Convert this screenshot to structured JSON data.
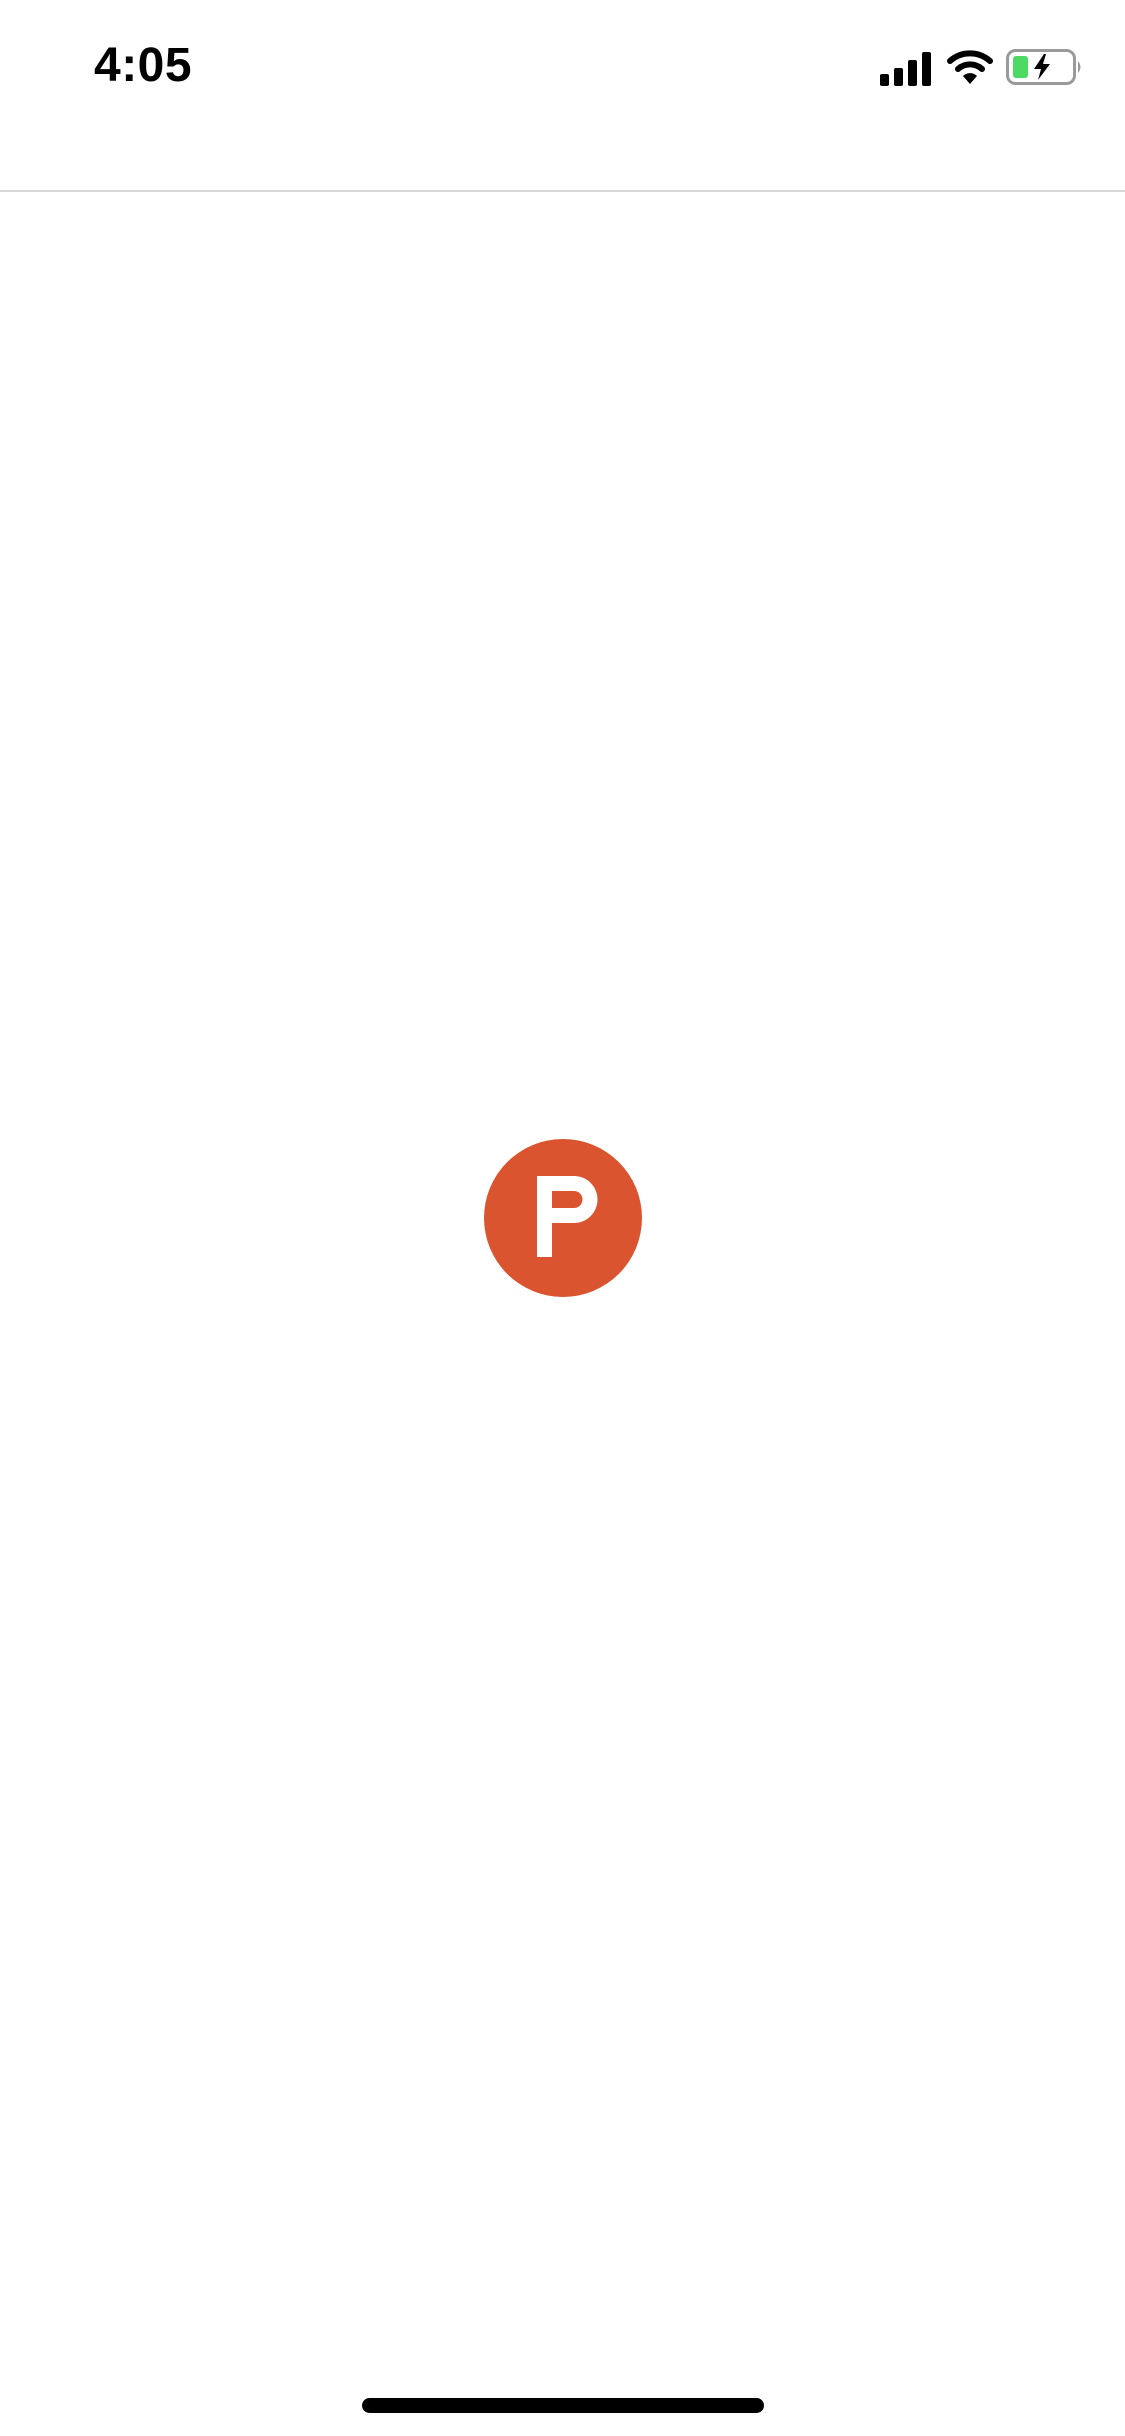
{
  "status_bar": {
    "time": "4:05",
    "signal_icon": "cellular-signal-icon",
    "wifi_icon": "wifi-icon",
    "battery_icon": "battery-charging-icon"
  },
  "content": {
    "logo_icon": "product-hunt-logo-icon",
    "logo_letter": "P"
  },
  "colors": {
    "brand": "#DA552F",
    "battery_fill": "#4CD964",
    "separator": "#D8D8D8"
  }
}
